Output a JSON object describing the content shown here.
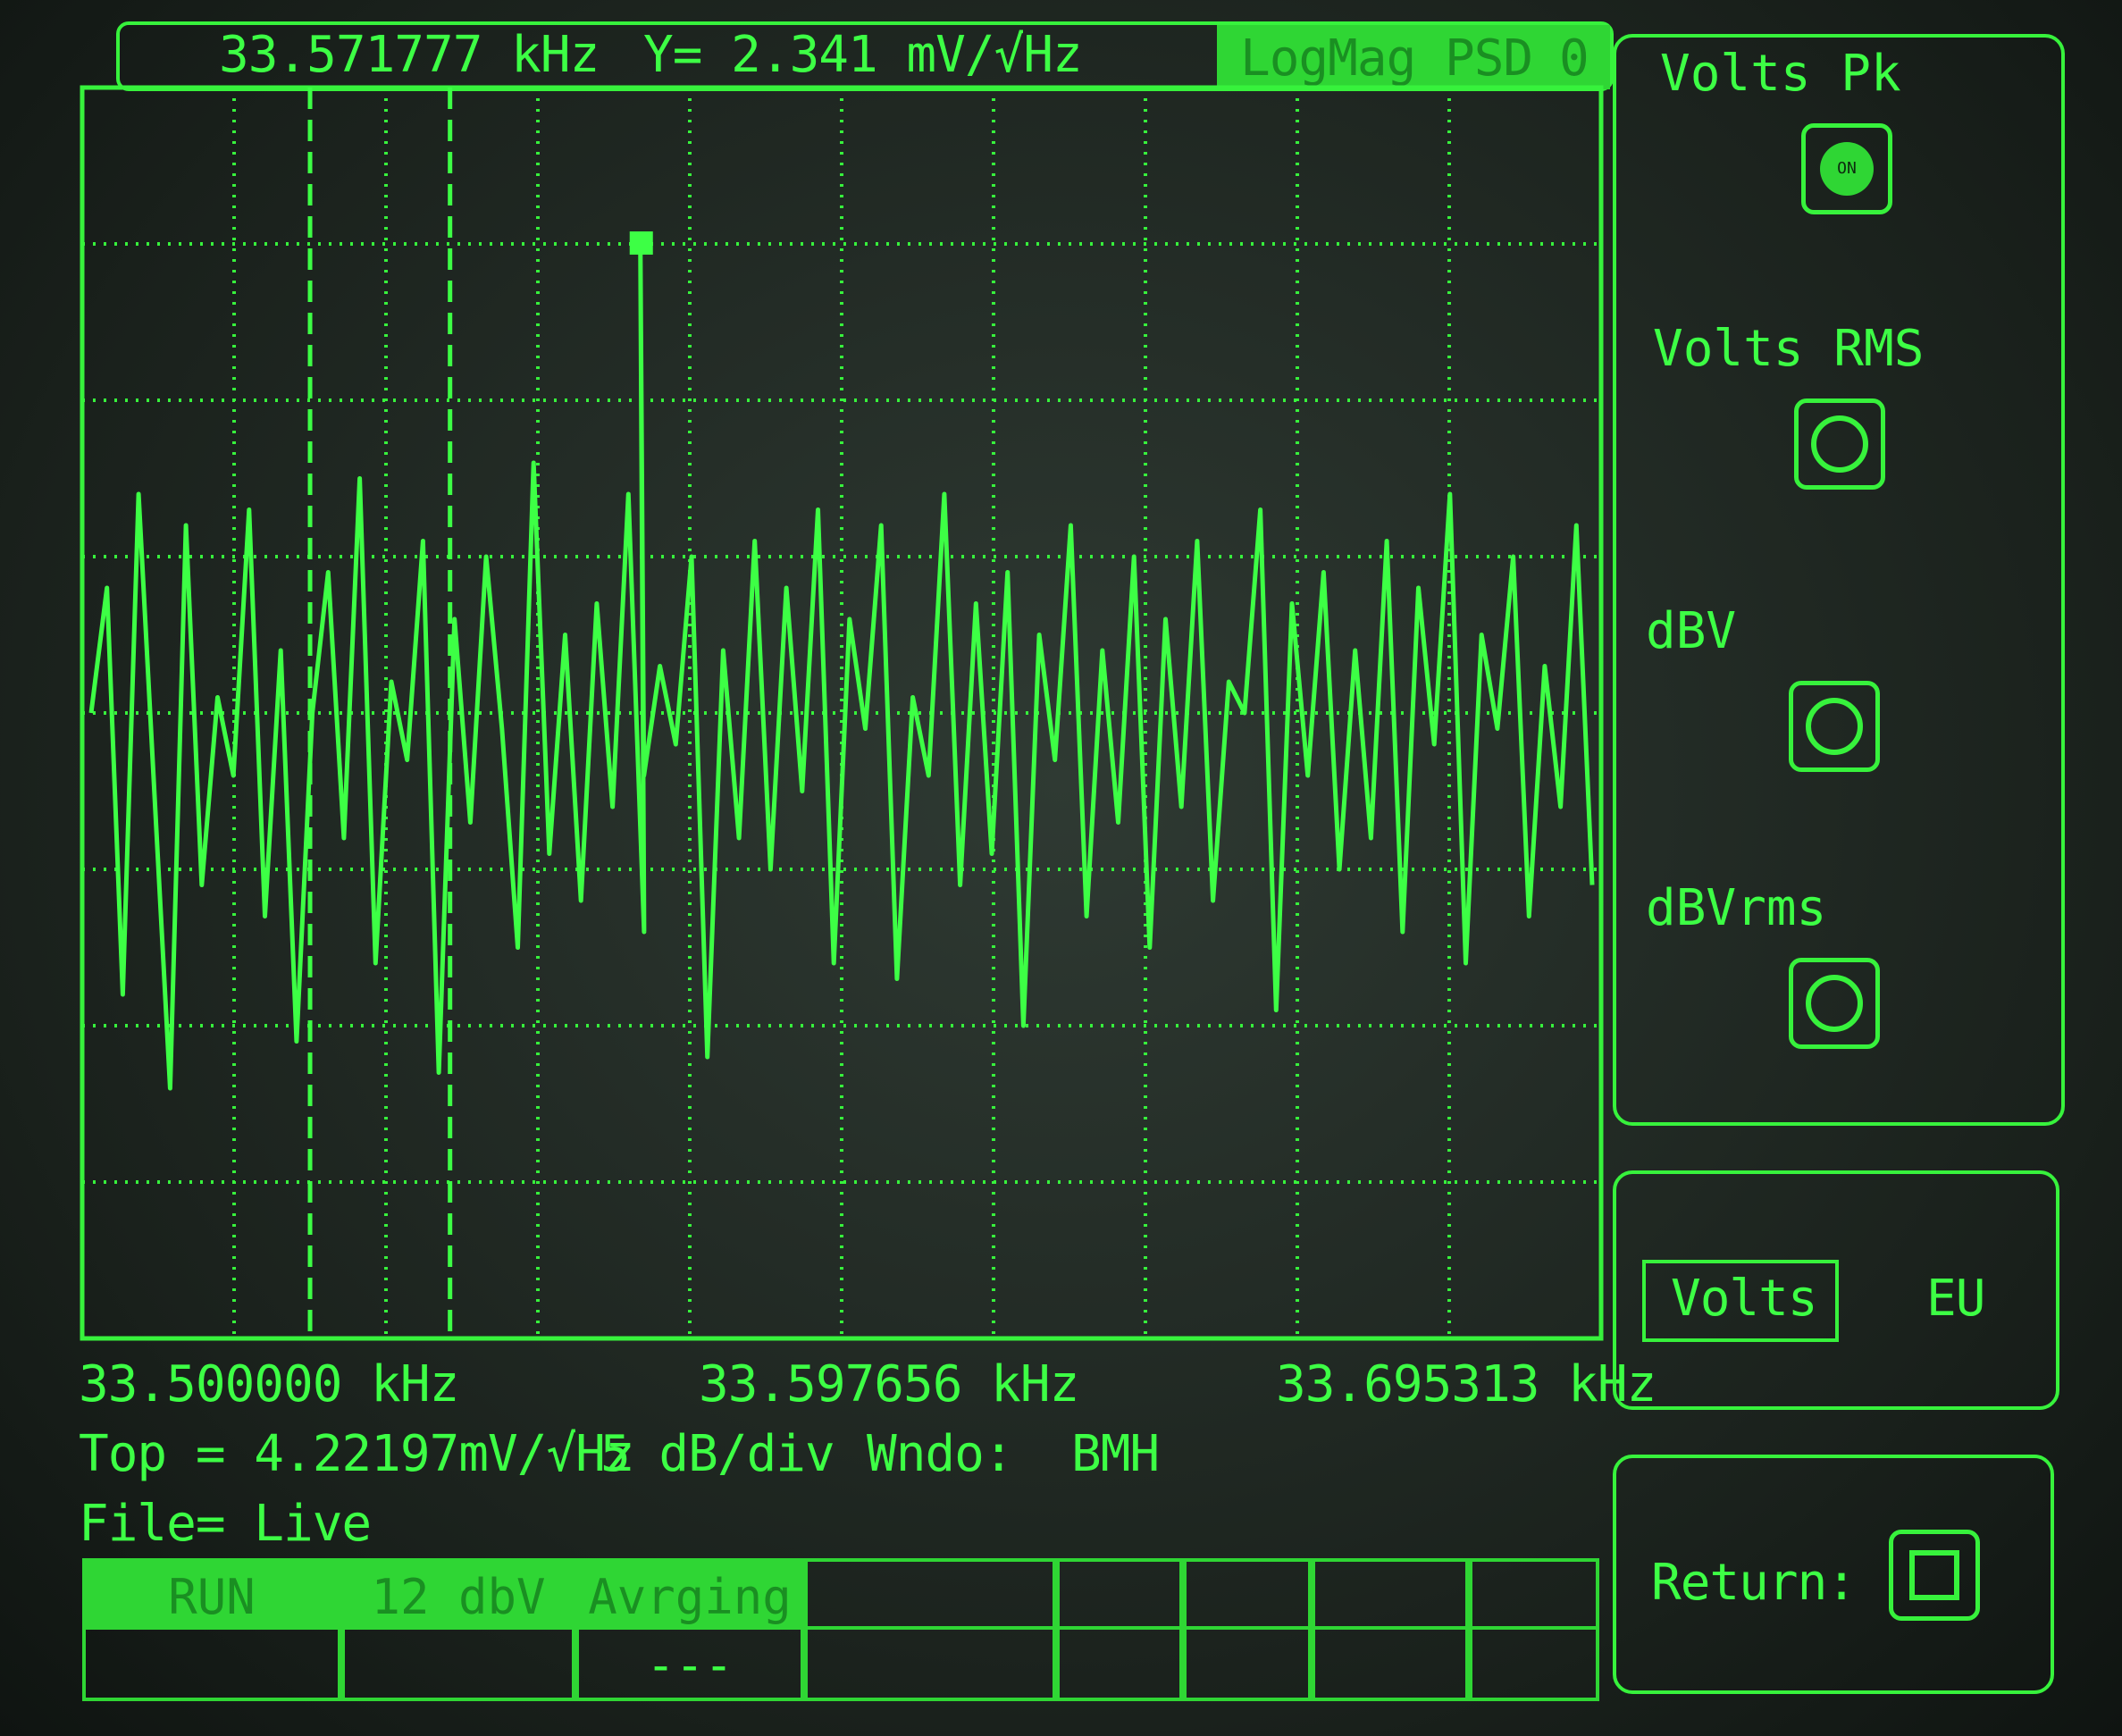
{
  "header": {
    "marker_freq": "33.571777 kHz",
    "marker_y": "Y= 2.341 mV/√Hz",
    "measurement": "LogMag PSD",
    "trace_index": "0"
  },
  "freq_axis": {
    "start": "33.500000 kHz",
    "center": "33.597656 kHz",
    "end": "33.695313 kHz"
  },
  "status": {
    "top": "Top = 4.22197mV/√Hz",
    "scale": "5 dB/div",
    "window": "Wndo:  BMH",
    "file": "File= Live"
  },
  "softkeys": [
    {
      "label": "Volts Pk",
      "state": "ON"
    },
    {
      "label": "Volts RMS",
      "state": ""
    },
    {
      "label": "dBV",
      "state": ""
    },
    {
      "label": "dBVrms",
      "state": ""
    }
  ],
  "units": {
    "selected": "Volts",
    "other": "EU"
  },
  "return_label": "Return:",
  "bottom_bar": {
    "top_cells": [
      "RUN",
      "12 dbV",
      "Avrging",
      "",
      "",
      "",
      "",
      ""
    ],
    "bottom_cells": [
      "",
      "",
      "---",
      "",
      "",
      "",
      "",
      ""
    ]
  },
  "colors": {
    "phosphor": "#39ff3f",
    "background": "#1d2420"
  },
  "chart_data": {
    "type": "line",
    "title": "",
    "xlabel": "",
    "ylabel": "",
    "xlim_khz": [
      33.5,
      33.695313
    ],
    "divisions_x": 10,
    "divisions_y": 8,
    "y_units": "div below top (5 dB/div)",
    "grid": true,
    "marker": {
      "x_khz": 33.571777,
      "y_value": "2.341 mV/√Hz"
    },
    "cursor_lines_khz": [
      33.5293,
      33.5473
    ],
    "series": [
      {
        "values": [
          4.0,
          3.2,
          5.8,
          2.6,
          4.5,
          6.4,
          2.8,
          5.1,
          3.9,
          4.4,
          2.7,
          5.3,
          3.6,
          6.1,
          4.0,
          3.1,
          4.8,
          2.5,
          5.6,
          3.8,
          4.3,
          2.9,
          6.3,
          3.4,
          4.7,
          3.0,
          4.1,
          5.5,
          2.4,
          4.9,
          3.5,
          5.2,
          3.3,
          4.6,
          2.6,
          5.4,
          3.7,
          4.2,
          3.0,
          6.2,
          3.6,
          4.8,
          2.9,
          5.0,
          3.2,
          4.5,
          2.7,
          5.6,
          3.4,
          4.1,
          2.8,
          5.7,
          3.9,
          4.4,
          2.6,
          5.1,
          3.3,
          4.9,
          3.1,
          6.0,
          3.5,
          4.3,
          2.8,
          5.3,
          3.6,
          4.7,
          3.0,
          5.5,
          3.4,
          4.6,
          2.9,
          5.2,
          3.8,
          4.0,
          2.7,
          5.9,
          3.3,
          4.4,
          3.1,
          5.0,
          3.6,
          4.8,
          2.9,
          5.4,
          3.2,
          4.2,
          2.6,
          5.6,
          3.5,
          4.1,
          3.0,
          5.3,
          3.7,
          4.6,
          2.8,
          5.1
        ]
      }
    ]
  }
}
